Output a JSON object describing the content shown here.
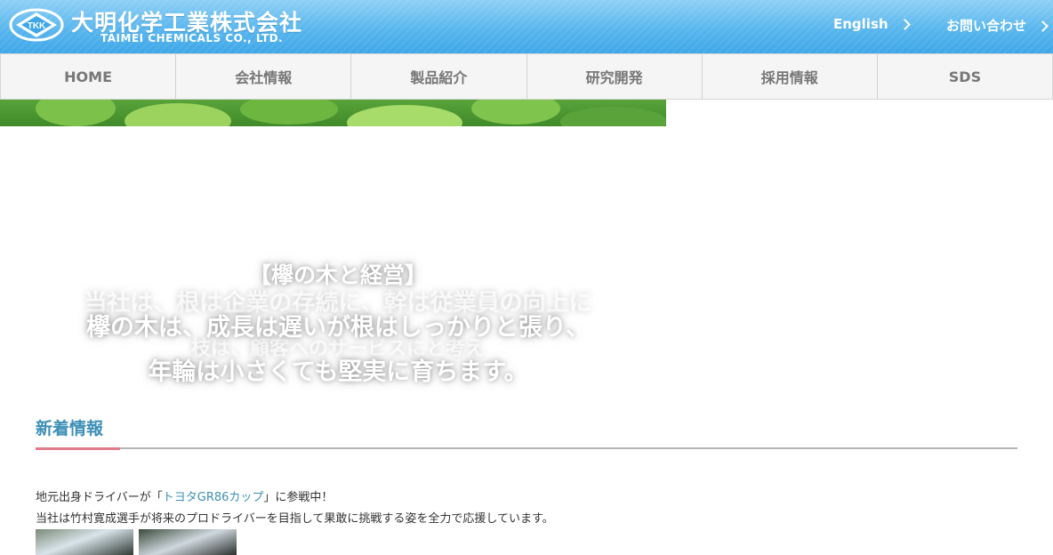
{
  "header": {
    "logo_mark_text": "TKK",
    "company_jp": "大明化学工業株式会社",
    "company_en": "TAIMEI CHEMICALS CO., LTD.",
    "english_link": "English",
    "contact_link": "お問い合わせ"
  },
  "nav": {
    "items": [
      {
        "label": "HOME"
      },
      {
        "label": "会社情報"
      },
      {
        "label": "製品紹介"
      },
      {
        "label": "研究開発"
      },
      {
        "label": "採用情報"
      },
      {
        "label": "SDS"
      }
    ]
  },
  "hero": {
    "quote_title": "【欅の木と経営】",
    "ghost_line_1": "当社は、根は企業の存続に、幹は従業員の向上に",
    "ghost_line_2": "枝は、顧客へのサービスにと考え",
    "quote_line_1": "欅の木は、成長は遅いが根はしっかりと張り、",
    "quote_line_2": "年輪は小さくても堅実に育ちます。"
  },
  "news": {
    "heading": "新着情報",
    "line1_prefix": "地元出身ドライバーが「",
    "line1_link": "トヨタGR86カップ",
    "line1_suffix": "」に参戦中！",
    "line2": "当社は竹村寛成選手が将来のプロドライバーを目指して果敢に挑戦する姿を全力で応援しています。"
  },
  "colors": {
    "header_blue": "#58b6ee",
    "nav_text": "#777777",
    "news_heading": "#3d8fb5",
    "accent_pink": "#e07b8a"
  }
}
